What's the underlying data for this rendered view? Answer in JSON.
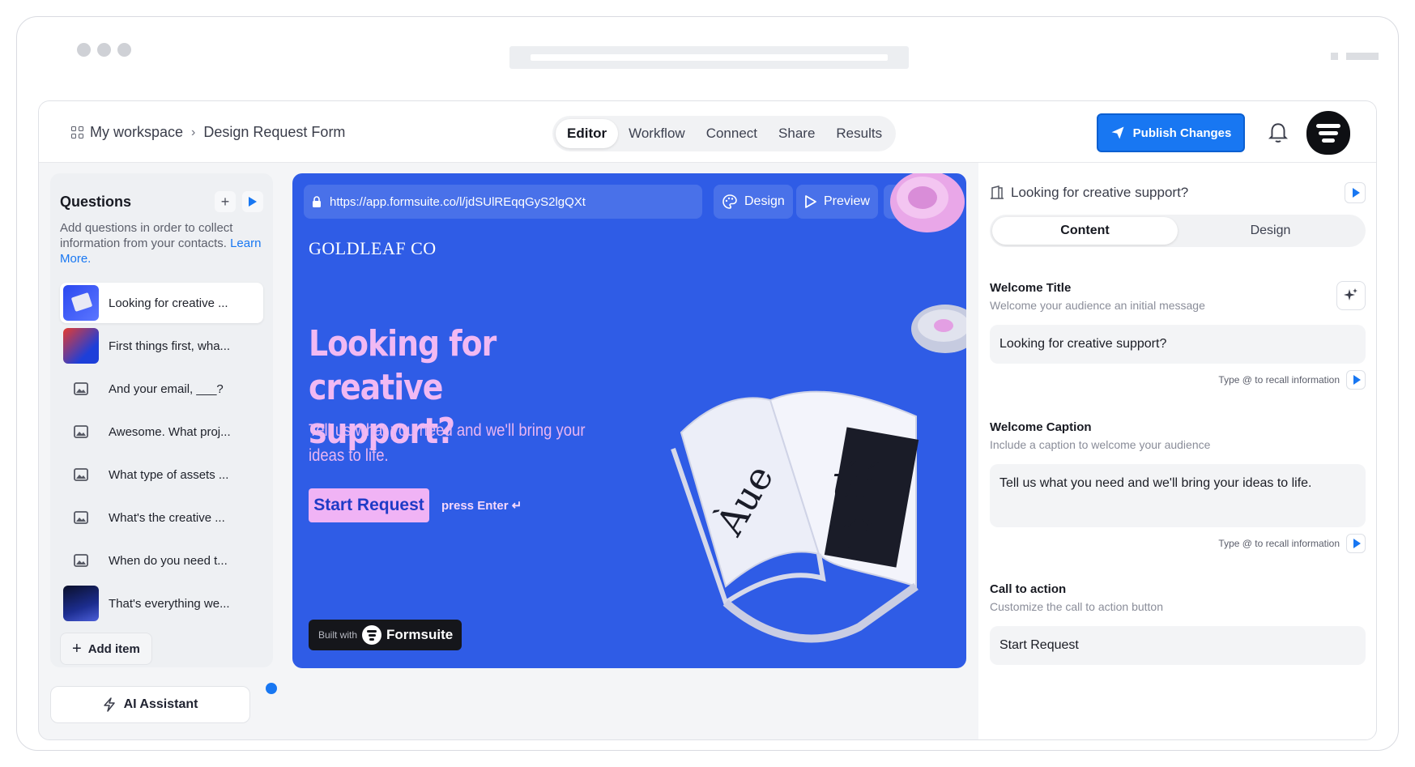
{
  "topbar": {
    "workspace": "My workspace",
    "form_name": "Design Request Form",
    "tabs": [
      {
        "label": "Editor",
        "active": true
      },
      {
        "label": "Workflow",
        "active": false
      },
      {
        "label": "Connect",
        "active": false
      },
      {
        "label": "Share",
        "active": false
      },
      {
        "label": "Results",
        "active": false
      }
    ],
    "publish_label": "Publish Changes",
    "accent_color": "#1877f2"
  },
  "questions_panel": {
    "title": "Questions",
    "description": "Add questions in order to collect information from your contacts.",
    "learn_more": "Learn More.",
    "items": [
      {
        "label": "Looking for creative ...",
        "selected": true,
        "thumb": "image"
      },
      {
        "label": "First things first, wha...",
        "selected": false,
        "thumb": "image"
      },
      {
        "label": "And your email, ___?",
        "selected": false,
        "thumb": "image-icon"
      },
      {
        "label": "Awesome. What proj...",
        "selected": false,
        "thumb": "image-icon"
      },
      {
        "label": "What type of assets ...",
        "selected": false,
        "thumb": "image-icon"
      },
      {
        "label": "What's the creative ...",
        "selected": false,
        "thumb": "image-icon"
      },
      {
        "label": "When do you need t...",
        "selected": false,
        "thumb": "image-icon"
      },
      {
        "label": "That's everything we...",
        "selected": false,
        "thumb": "image"
      }
    ],
    "add_item": "Add item",
    "ai_assistant": "AI Assistant"
  },
  "preview": {
    "url": "https://app.formsuite.co/l/jdSUlREqqGyS2lgQXt",
    "design_label": "Design",
    "preview_label": "Preview",
    "brand": "GOLDLEAF CO",
    "headline": "Looking for creative support?",
    "subtitle": "Tell us what you need and we'll bring your ideas to life.",
    "cta": "Start Request",
    "press_enter": "press Enter ↵",
    "built_with": "Built with",
    "built_brand": "Formsuite",
    "background_color": "#2f5ce6",
    "headline_color": "#f1b9f3"
  },
  "settings": {
    "screen_title": "Looking for creative support?",
    "tabs": [
      {
        "label": "Content",
        "active": true
      },
      {
        "label": "Design",
        "active": false
      }
    ],
    "fields": [
      {
        "label": "Welcome Title",
        "hint": "Welcome your audience an initial message",
        "value": "Looking for creative support?",
        "recall": "Type @ to recall information"
      },
      {
        "label": "Welcome Caption",
        "hint": "Include a caption to welcome your audience",
        "value": "Tell us what you need and we'll bring your ideas to life.",
        "recall": "Type @ to recall information"
      },
      {
        "label": "Call to action",
        "hint": "Customize the call to action button",
        "value": "Start Request"
      }
    ]
  }
}
